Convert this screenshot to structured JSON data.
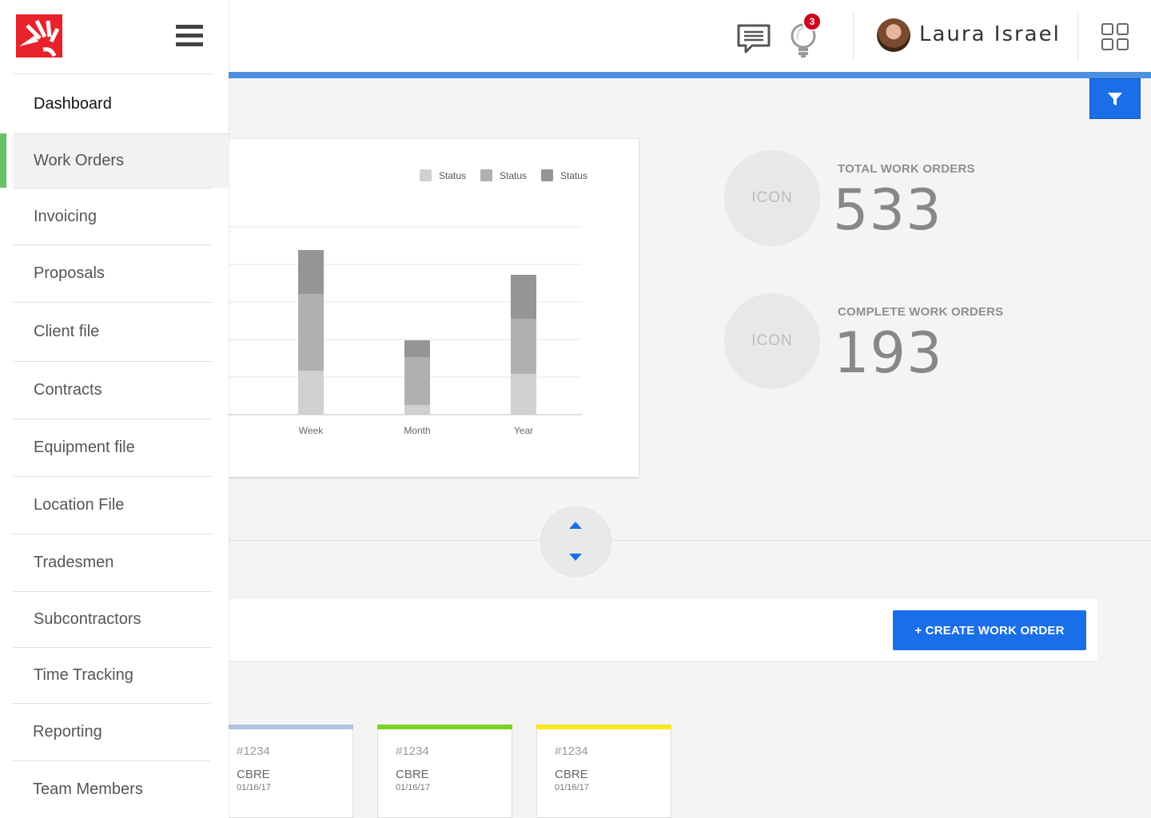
{
  "header": {
    "user_name": "Laura Israel",
    "notification_count": "3",
    "icons": [
      "chat-icon",
      "lightbulb-icon",
      "apps-grid-icon"
    ],
    "accent_color": "#4a8fe0"
  },
  "sidebar": {
    "logo": "brand-logo",
    "items": [
      {
        "label": "Dashboard"
      },
      {
        "label": "Work Orders",
        "active": true
      },
      {
        "label": "Invoicing"
      },
      {
        "label": "Proposals"
      },
      {
        "label": "Client file"
      },
      {
        "label": "Contracts"
      },
      {
        "label": "Equipment file"
      },
      {
        "label": "Location File"
      },
      {
        "label": "Tradesmen"
      },
      {
        "label": "Subcontractors"
      },
      {
        "label": "Time Tracking"
      },
      {
        "label": "Reporting"
      },
      {
        "label": "Team Members"
      }
    ],
    "active_color": "#6abf69"
  },
  "chart_data": {
    "type": "bar",
    "stacked": true,
    "categories": [
      "Week",
      "Month",
      "Year"
    ],
    "series": [
      {
        "name": "Status",
        "color": "#d0d0d0",
        "values": [
          55,
          12,
          51
        ]
      },
      {
        "name": "Status",
        "color": "#b0b0b0",
        "values": [
          96,
          60,
          69
        ]
      },
      {
        "name": "Status",
        "color": "#959595",
        "values": [
          55,
          21,
          55
        ]
      }
    ],
    "ylim": [
      0,
      235
    ],
    "grid": true,
    "legend_position": "top-right"
  },
  "stats": [
    {
      "icon_label": "ICON",
      "label": "TOTAL WORK ORDERS",
      "value": "533"
    },
    {
      "icon_label": "ICON",
      "label": "COMPLETE WORK ORDERS",
      "value": "193"
    }
  ],
  "actions": {
    "create_label": "+ CREATE WORK ORDER",
    "button_color": "#1a6ee8"
  },
  "orders": [
    {
      "id": "#1234",
      "client": "CBRE",
      "date": "01/16/17",
      "color": "#aec4e6"
    },
    {
      "id": "#1234",
      "client": "CBRE",
      "date": "01/16/17",
      "color": "#7ed321"
    },
    {
      "id": "#1234",
      "client": "CBRE",
      "date": "01/16/17",
      "color": "#f8e71c"
    }
  ]
}
